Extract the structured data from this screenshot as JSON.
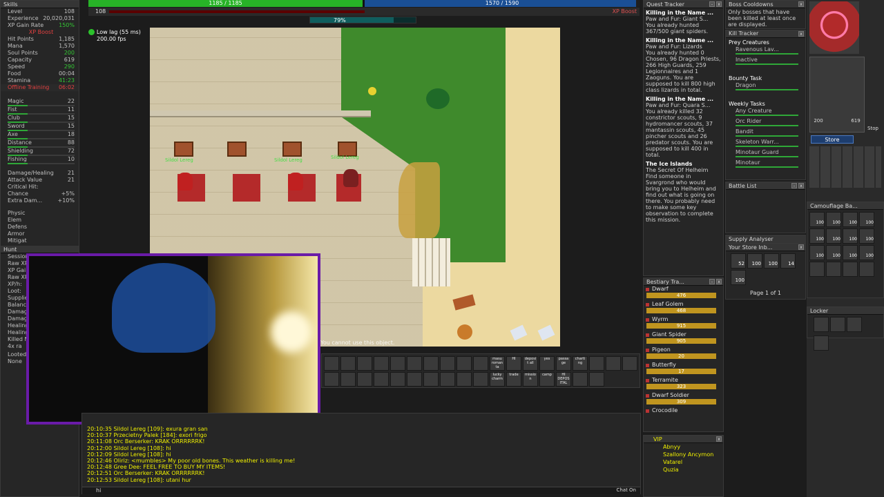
{
  "skills": {
    "title": "Skills",
    "rows": [
      {
        "label": "Level",
        "value": "108"
      },
      {
        "label": "Experience",
        "value": "20,020,031"
      },
      {
        "label": "XP Gain Rate",
        "value": "150%"
      },
      {
        "label": "",
        "value": "XP Boost"
      },
      {
        "label": "Hit Points",
        "value": "1,185"
      },
      {
        "label": "Mana",
        "value": "1,570"
      },
      {
        "label": "Soul Points",
        "value": "200"
      },
      {
        "label": "Capacity",
        "value": "619"
      },
      {
        "label": "Speed",
        "value": "290"
      },
      {
        "label": "Food",
        "value": "00:04"
      },
      {
        "label": "Stamina",
        "value": "41:23"
      },
      {
        "label": "Offline Training",
        "value": "06:02"
      }
    ],
    "combat": [
      {
        "label": "Magic",
        "value": "22"
      },
      {
        "label": "Fist",
        "value": "11"
      },
      {
        "label": "Club",
        "value": "15"
      },
      {
        "label": "Sword",
        "value": "15"
      },
      {
        "label": "Axe",
        "value": "18"
      },
      {
        "label": "Distance",
        "value": "88"
      },
      {
        "label": "Shielding",
        "value": "72"
      },
      {
        "label": "Fishing",
        "value": "10"
      }
    ],
    "extra": [
      {
        "label": "Damage/Healing",
        "value": "21"
      },
      {
        "label": "Attack Value",
        "value": "21"
      },
      {
        "label": "Critical Hit:",
        "value": ""
      },
      {
        "label": "Chance",
        "value": "+5%"
      },
      {
        "label": "Extra Dam...",
        "value": "+10%"
      }
    ],
    "lower": [
      "Physic",
      "Elem",
      "Defens",
      "Armor",
      "Mitigat"
    ],
    "hunt_title": "Hunt",
    "hunt": [
      "Session",
      "Raw XP",
      "XP Gai",
      "Raw XP",
      "XP/h:",
      "Loot:",
      "Supplie",
      "Balanc",
      "Damag",
      "Damag",
      "Healing",
      "Healing",
      "Killed M",
      "4x ra"
    ],
    "looted_label": "Looted Items:",
    "looted_value": "None"
  },
  "hp": {
    "text": "1185 / 1185",
    "fill": 1.0
  },
  "mana": {
    "text": "1570 / 1590",
    "fill": 0.987
  },
  "level_label": "108",
  "xp_boost": "XP Boost",
  "xp_progress": "79%",
  "status": {
    "lag": "Low lag (55 ms)",
    "fps": "200.00 fps"
  },
  "player_names": [
    "Sildol Lereg",
    "Sildol Lereg",
    "Sildol Lereg"
  ],
  "game_status_text": "You cannot use this object.",
  "chat": {
    "lines": [
      "20:10:35 Sildol Lereg [109]: exura gran san",
      "20:10:37 Przecietny Palek [184]: exori frigo",
      "20:11:08 Orc Berserker: KRAK ORRRRRRK!",
      "20:12:00 Sildol Lereg [108]: hi",
      "20:12:09 Sildol Lereg [108]: hi",
      "20:12:46 Oliriz: <mumbles> My poor old bones. This weather is killing me!",
      "20:12:48 Gree Dee: FEEL FREE TO BUY MY ITEMS!",
      "20:12:51 Orc Berserker: KRAK ORRRRRRK!",
      "20:12:53 Sildol Lereg [108]: utani hur"
    ],
    "input": "hi",
    "button": "Chat On"
  },
  "hotbar_labels": [
    "masu roman ta",
    "HI",
    "deposi t all",
    "yes",
    "passa ge",
    "charti ng",
    "lucky charm",
    "trade",
    "missio n",
    "camp",
    "HI DEPOS ITAL"
  ],
  "quest_tracker": {
    "title": "Quest Tracker",
    "entries": [
      {
        "title": "Killing in the Name ...",
        "sub": "Paw and Fur: Giant S...",
        "body": "You already hunted 367/500 giant spiders."
      },
      {
        "title": "Killing in the Name ...",
        "sub": "Paw and Fur: Lizards",
        "body": "You already hunted 0 Chosen, 96 Dragon Priests, 266 High Guards, 259 Legionnaires and 1 Zaoguns. You are supposed to kill 800 high class lizards in total."
      },
      {
        "title": "Killing in the Name ...",
        "sub": "Paw and Fur: Quara S...",
        "body": "You already killed 32 constrictor scouts, 9 hydromancer scouts, 37 mantassin scouts, 45 pincher scouts and 26 predator scouts. You are supposed to kill 400 in total."
      },
      {
        "title": "The Ice Islands",
        "sub": "The Secret Of Helheim",
        "body": "Find someone in Svargrond who would bring you to Helheim and find out what is going on there. You probably need to make some key observation to complete this mission."
      }
    ]
  },
  "boss_cooldowns": {
    "title": "Boss Cooldowns",
    "text": "Only bosses that have been killed at least once are displayed."
  },
  "kill_tracker": {
    "title": "Kill Tracker",
    "prey_title": "Prey Creatures",
    "prey": [
      "Ravenous Lav...",
      "Inactive"
    ],
    "bounty_title": "Bounty Task",
    "bounty": [
      "Dragon"
    ],
    "weekly_title": "Weekly Tasks",
    "weekly": [
      "Any Creature",
      "Orc Rider",
      "Bandit",
      "Skeleton Warr...",
      "Minotaur Guard",
      "Minotaur"
    ]
  },
  "battle_list": {
    "title": "Battle List"
  },
  "supply": {
    "title": "Supply Analyser"
  },
  "store_inbox": {
    "title": "Your Store Inb...",
    "counts": [
      "52",
      "100",
      "100",
      "14",
      "100"
    ],
    "page": "Page 1 of 1"
  },
  "bestiary": {
    "title": "Bestiary Tra...",
    "entries": [
      {
        "name": "Dwarf",
        "value": "476"
      },
      {
        "name": "Leaf Golem",
        "value": "468"
      },
      {
        "name": "Wyrm",
        "value": "915"
      },
      {
        "name": "Giant Spider",
        "value": "905"
      },
      {
        "name": "Pigeon",
        "value": "20"
      },
      {
        "name": "Butterfly",
        "value": "17"
      },
      {
        "name": "Terramite",
        "value": "323"
      },
      {
        "name": "Dwarf Soldier",
        "value": "309"
      },
      {
        "name": "Crocodile",
        "value": ""
      }
    ]
  },
  "vip": {
    "title": "VIP",
    "names": [
      "Abnyy",
      "Szallony Ancymon",
      "Vatarel",
      "Quzia"
    ]
  },
  "camouflage": {
    "title": "Camouflage Ba...",
    "count": "100"
  },
  "locker": {
    "title": "Locker"
  },
  "store_button": "Store",
  "inv_stats": {
    "soul": "200",
    "cap": "619",
    "stop": "Stop"
  }
}
